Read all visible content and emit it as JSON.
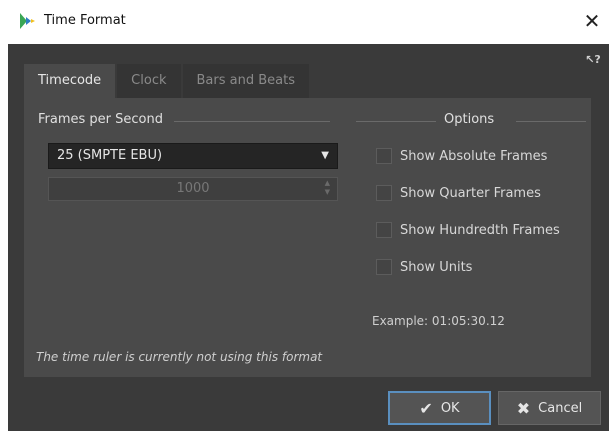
{
  "window": {
    "title": "Time Format"
  },
  "tabs": [
    {
      "label": "Timecode",
      "active": true
    },
    {
      "label": "Clock",
      "active": false
    },
    {
      "label": "Bars and Beats",
      "active": false
    }
  ],
  "timecode": {
    "fps_label": "Frames per Second",
    "fps_selected": "25 (SMPTE EBU)",
    "custom_fps_value": "1000"
  },
  "options": {
    "title": "Options",
    "items": [
      {
        "label": "Show Absolute Frames",
        "checked": false
      },
      {
        "label": "Show Quarter Frames",
        "checked": false
      },
      {
        "label": "Show Hundredth Frames",
        "checked": false
      },
      {
        "label": "Show Units",
        "checked": false
      }
    ]
  },
  "example": "Example: 01:05:30.12",
  "footnote": "The time ruler is currently not using this format",
  "buttons": {
    "ok": "OK",
    "cancel": "Cancel"
  },
  "icons": {
    "app": "app-logo-icon",
    "close": "close-icon",
    "help": "help-icon",
    "dropdown": "chevron-down-icon",
    "ok": "checkmark-icon",
    "cancel": "x-icon"
  },
  "colors": {
    "dialog_bg": "#3a3a3a",
    "panel_bg": "#4a4a4a",
    "ok_border": "#5a8fbf"
  }
}
